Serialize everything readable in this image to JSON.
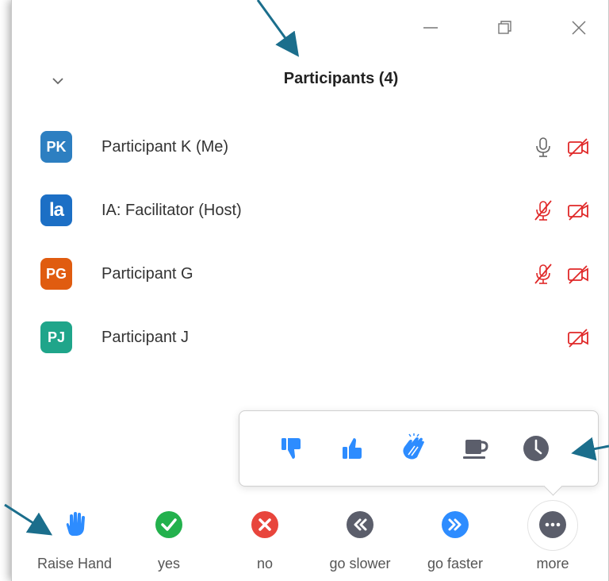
{
  "window": {
    "title": "Participants (4)"
  },
  "participants": [
    {
      "initials": "PK",
      "name": "Participant K (Me)",
      "color": "#2d7fc1",
      "mic": "on",
      "video": "off"
    },
    {
      "initials": "la",
      "name": "IA: Facilitator (Host)",
      "color": "#1c6fc5",
      "mic": "muted",
      "video": "off"
    },
    {
      "initials": "PG",
      "name": "Participant G",
      "color": "#e05c10",
      "mic": "muted",
      "video": "off"
    },
    {
      "initials": "PJ",
      "name": "Participant J",
      "color": "#1fa58a",
      "mic": "none",
      "video": "off"
    }
  ],
  "reactions_popover": [
    {
      "name": "thumbs-down-icon"
    },
    {
      "name": "thumbs-up-icon"
    },
    {
      "name": "clap-icon"
    },
    {
      "name": "coffee-icon"
    },
    {
      "name": "clock-icon"
    }
  ],
  "toolbar": {
    "raise_hand": "Raise Hand",
    "yes": "yes",
    "no": "no",
    "go_slower": "go slower",
    "go_faster": "go faster",
    "more": "more"
  },
  "colors": {
    "accent_blue": "#2d8cff",
    "yes_green": "#23b14d",
    "no_red": "#e8453c",
    "gray_icon": "#5b5e6b",
    "muted_red": "#e02828",
    "annotation_arrow": "#1b6e8c"
  }
}
